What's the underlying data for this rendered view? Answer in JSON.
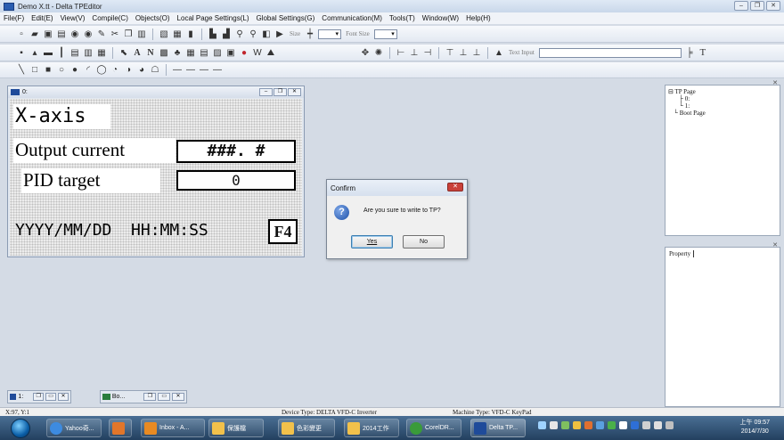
{
  "window": {
    "title": "Demo X.tt - Delta TPEditor",
    "controls": [
      "–",
      "❐",
      "✕"
    ]
  },
  "menu": [
    "File(F)",
    "Edit(E)",
    "View(V)",
    "Compile(C)",
    "Objects(O)",
    "Local Page Settings(L)",
    "Global Settings(G)",
    "Communication(M)",
    "Tools(T)",
    "Window(W)",
    "Help(H)"
  ],
  "toolbar": {
    "size_label": "Size",
    "font_size_label": "Font Size",
    "text_input_label": "Text Input",
    "text_tool_label": "T"
  },
  "lcd_window": {
    "title": "0:",
    "xaxis": "X-axis",
    "output_label": "Output current",
    "output_value": "###. #",
    "pid_label": "PID target",
    "pid_value": "0",
    "datetime": "YYYY/MM/DD  HH:MM:SS",
    "f4": "F4"
  },
  "dialog": {
    "title": "Confirm",
    "message": "Are you sure to write to TP?",
    "yes": "Yes",
    "no": "No"
  },
  "tree": {
    "root": "TP Page",
    "items": [
      "0:",
      "1:"
    ],
    "boot": "Boot Page"
  },
  "property": {
    "label": "Property"
  },
  "minimized": [
    {
      "label": "1:"
    },
    {
      "label": "Bo..."
    }
  ],
  "status": {
    "coords": "X:97, Y:1",
    "device": "Device Type: DELTA VFD-C Inverter",
    "machine": "Machine Type: VFD-C KeyPad"
  },
  "taskbar": {
    "items": [
      "Yahoo奇...",
      "Inbox - A...",
      "保護檔",
      "色彩變更",
      "2014工作",
      "CorelDR...",
      "Delta TP..."
    ],
    "time": "上午 09:57",
    "date": "2014/7/30"
  }
}
